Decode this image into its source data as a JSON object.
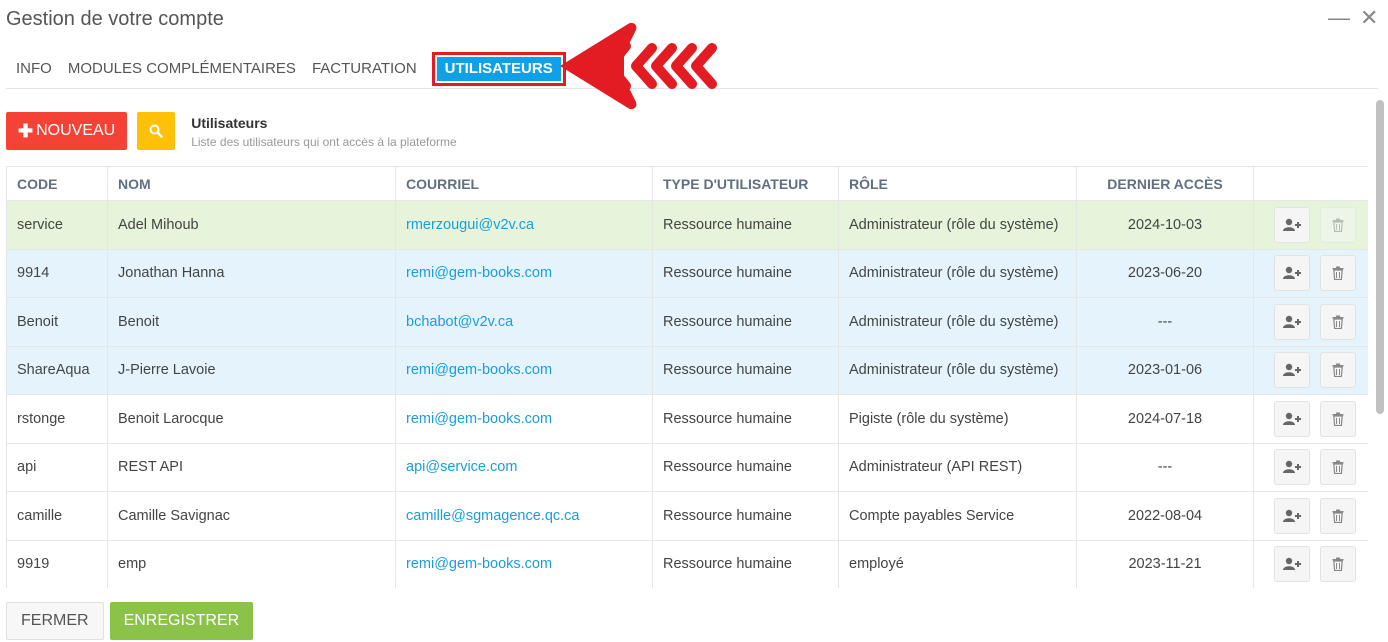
{
  "window": {
    "title": "Gestion de votre compte",
    "minimize": "—",
    "close": "✕"
  },
  "tabs": [
    {
      "label": "INFO",
      "active": false
    },
    {
      "label": "MODULES COMPLÉMENTAIRES",
      "active": false
    },
    {
      "label": "FACTURATION",
      "active": false
    },
    {
      "label": "UTILISATEURS",
      "active": true
    }
  ],
  "toolbar": {
    "new_label": "NOUVEAU",
    "new_icon": "plus-icon",
    "search_icon": "search-icon",
    "section_title": "Utilisateurs",
    "section_subtitle": "Liste des utilisateurs qui ont accès à la plateforme"
  },
  "table": {
    "columns": [
      "CODE",
      "NOM",
      "COURRIEL",
      "TYPE D'UTILISATEUR",
      "RÔLE",
      "DERNIER ACCÈS"
    ],
    "rows": [
      {
        "code": "service",
        "nom": "Adel Mihoub",
        "courriel": "rmerzougui@v2v.ca",
        "type": "Ressource humaine",
        "role": "Administrateur (rôle du système)",
        "dernier": "2024-10-03",
        "highlight": "green"
      },
      {
        "code": "9914",
        "nom": "Jonathan Hanna",
        "courriel": "remi@gem-books.com",
        "type": "Ressource humaine",
        "role": "Administrateur (rôle du système)",
        "dernier": "2023-06-20",
        "highlight": "blue"
      },
      {
        "code": "Benoit",
        "nom": "Benoit",
        "courriel": "bchabot@v2v.ca",
        "type": "Ressource humaine",
        "role": "Administrateur (rôle du système)",
        "dernier": "---",
        "highlight": "blue"
      },
      {
        "code": "ShareAqua",
        "nom": "J-Pierre Lavoie",
        "courriel": "remi@gem-books.com",
        "type": "Ressource humaine",
        "role": "Administrateur (rôle du système)",
        "dernier": "2023-01-06",
        "highlight": "blue"
      },
      {
        "code": "rstonge",
        "nom": "Benoit Larocque",
        "courriel": "remi@gem-books.com",
        "type": "Ressource humaine",
        "role": "Pigiste (rôle du système)",
        "dernier": "2024-07-18",
        "highlight": ""
      },
      {
        "code": "api",
        "nom": "REST API",
        "courriel": "api@service.com",
        "type": "Ressource humaine",
        "role": "Administrateur (API REST)",
        "dernier": "---",
        "highlight": ""
      },
      {
        "code": "camille",
        "nom": "Camille Savignac",
        "courriel": "camille@sgmagence.qc.ca",
        "type": "Ressource humaine",
        "role": "Compte payables Service",
        "dernier": "2022-08-04",
        "highlight": ""
      },
      {
        "code": "9919",
        "nom": "emp",
        "courriel": "remi@gem-books.com",
        "type": "Ressource humaine",
        "role": "employé",
        "dernier": "2023-11-21",
        "highlight": ""
      }
    ],
    "row_actions": [
      "add-user-icon",
      "trash-icon"
    ]
  },
  "footer": {
    "close_label": "FERMER",
    "save_label": "ENREGISTRER"
  },
  "colors": {
    "accent": "#10a0e6",
    "danger": "#f44336",
    "warning": "#ffc107",
    "success": "#8bc34a",
    "annotation": "#e31b23"
  }
}
